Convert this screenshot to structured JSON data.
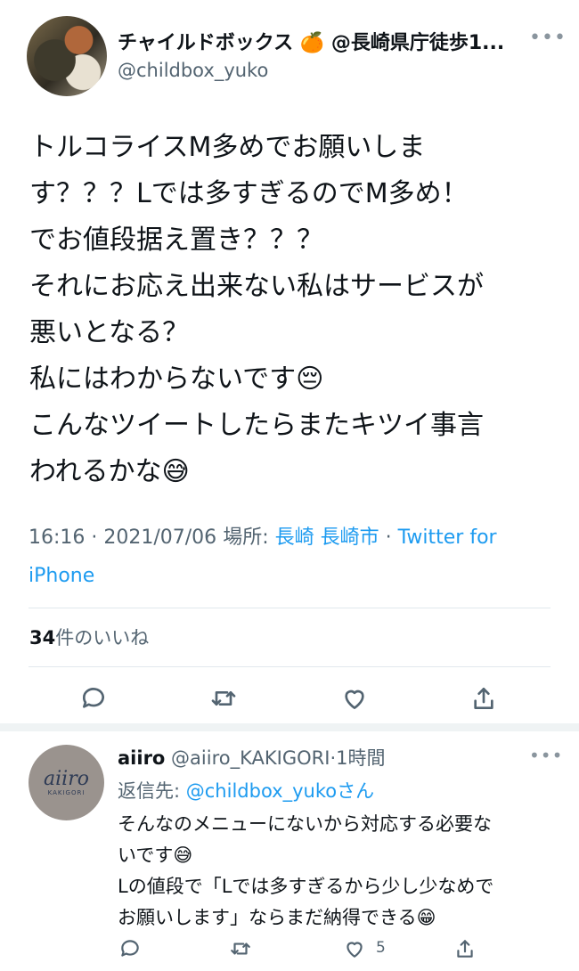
{
  "tweet": {
    "display_name": "チャイルドボックス 🍊 @長崎県庁徒歩1...",
    "handle": "@childbox_yuko",
    "more_icon": "more-horizontal-icon",
    "text": "トルコライスM多めでお願いしま\nす？？？Lでは多すぎるのでM多め！\nでお値段据え置き？？？\nそれにお応え出来ない私はサービスが\n悪いとなる？\n私にはわからないです😔\nこんなツイートしたらまたキツイ事言\nわれるかな😅",
    "time": "16:16 · 2021/07/06",
    "location_label": "場所:",
    "location": "長崎 長崎市",
    "source_sep": "·",
    "source": "Twitter for iPhone",
    "likes_count": "34",
    "likes_label": "件のいいね"
  },
  "actions": [
    "reply-icon",
    "retweet-icon",
    "like-icon",
    "share-icon"
  ],
  "reply": {
    "name": "aiiro",
    "handle": "@aiiro_KAKIGORI",
    "sep": "·",
    "time": "1時間",
    "replying_label": "返信先:",
    "replying_to": "@childbox_yukoさん",
    "text": "そんなのメニューにないから対応する必要な\nいです😅\nLの値段で「Lでは多すぎるから少し少なめで\nお願いします」ならまだ納得できる😁",
    "avatar_text": "aiiro",
    "avatar_subtext": "KAKIGORI",
    "like_count": "5"
  },
  "colors": {
    "link": "#1d9bf0",
    "secondary": "#536471",
    "text": "#0f1419"
  }
}
